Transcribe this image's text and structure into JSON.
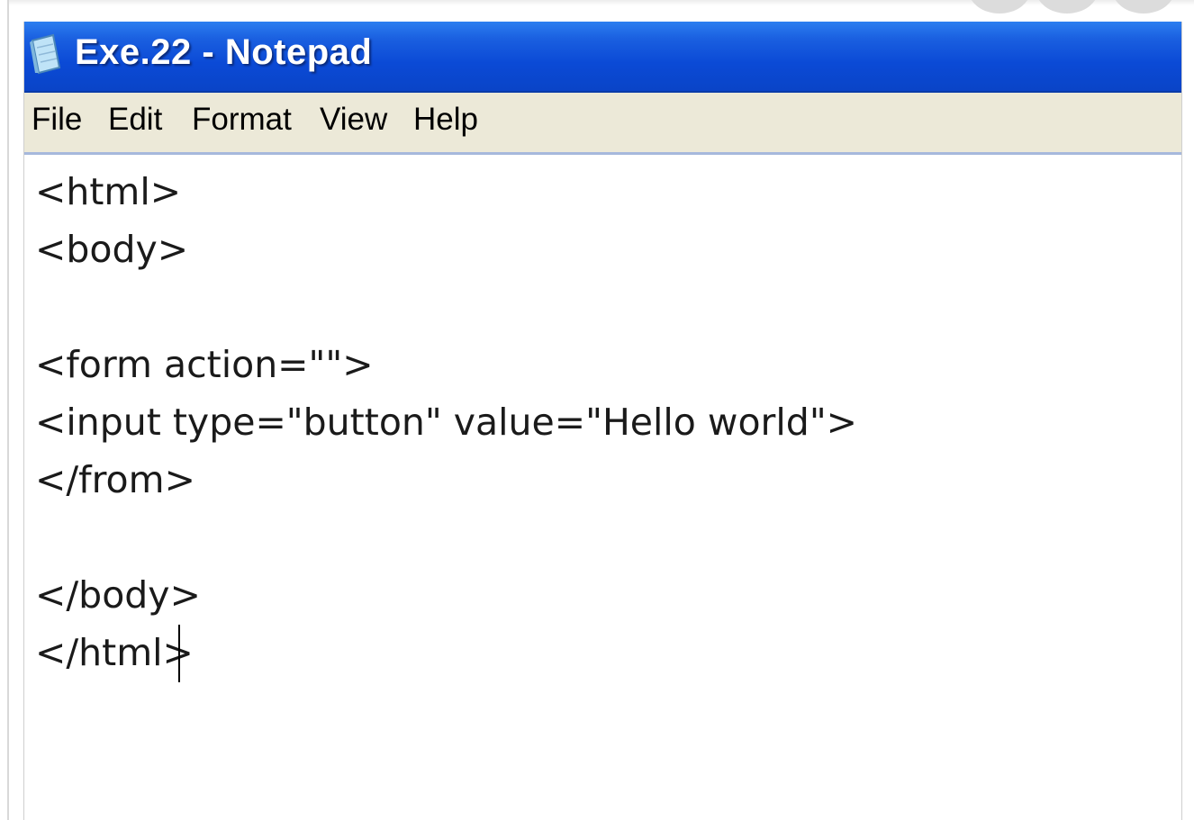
{
  "window": {
    "title": "Exe.22 - Notepad"
  },
  "icons": {
    "app": "notepad-icon"
  },
  "menu": {
    "items": [
      "File",
      "Edit",
      "Format",
      "View",
      "Help"
    ]
  },
  "editor": {
    "lines": [
      "<html>",
      "<body>",
      "",
      "<form action=\"\">",
      "<input type=\"button\" value=\"Hello world\">",
      "</from>",
      "",
      "</body>",
      "</html>"
    ]
  },
  "colors": {
    "titlebar": "#0b4ad6",
    "menubar": "#ece9d8",
    "menubar_border": "#a6b8dc",
    "text": "#1a1a1a"
  }
}
